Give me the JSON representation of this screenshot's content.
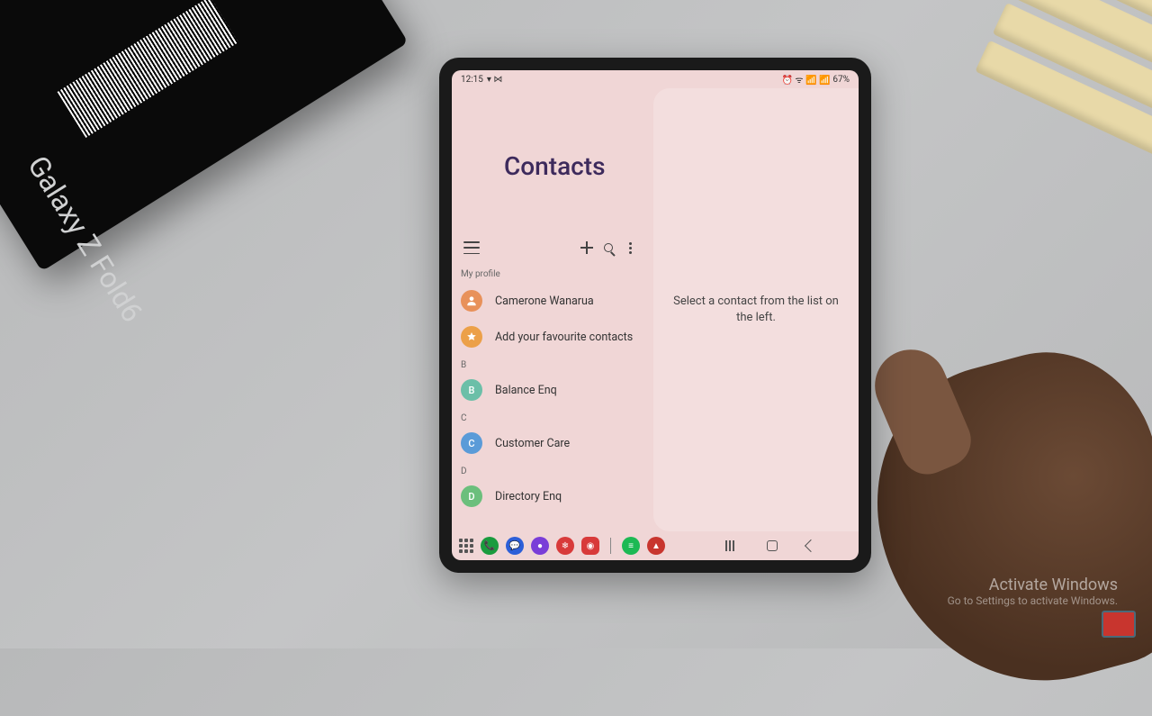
{
  "statusbar": {
    "time": "12:15",
    "indicators_left": "▾ ⋈",
    "battery": "67%",
    "icons_right": "⏰ ᯤ 📶 📶"
  },
  "header": {
    "title": "Contacts"
  },
  "toolbar": {
    "menu_label": "Menu",
    "add_label": "Add",
    "search_label": "Search",
    "more_label": "More"
  },
  "list": {
    "my_profile_label": "My profile",
    "profile_name": "Camerone Wanarua",
    "favourites_label": "Add your favourite contacts",
    "sections": [
      {
        "letter": "B",
        "items": [
          {
            "initial": "B",
            "name": "Balance Enq"
          }
        ]
      },
      {
        "letter": "C",
        "items": [
          {
            "initial": "C",
            "name": "Customer Care"
          }
        ]
      },
      {
        "letter": "D",
        "items": [
          {
            "initial": "D",
            "name": "Directory Enq"
          }
        ]
      }
    ]
  },
  "detail": {
    "empty_text": "Select a contact from the list on the left."
  },
  "taskbar": {
    "app_hints": [
      "apps",
      "phone",
      "messages",
      "browser",
      "snow",
      "camera",
      "spotify",
      "pdf"
    ]
  },
  "navbar": {
    "recent": "Recent",
    "home": "Home",
    "back": "Back"
  },
  "watermark": {
    "title": "Activate Windows",
    "sub": "Go to Settings to activate Windows."
  },
  "prop": {
    "box_text": "Galaxy Z Fold6"
  }
}
